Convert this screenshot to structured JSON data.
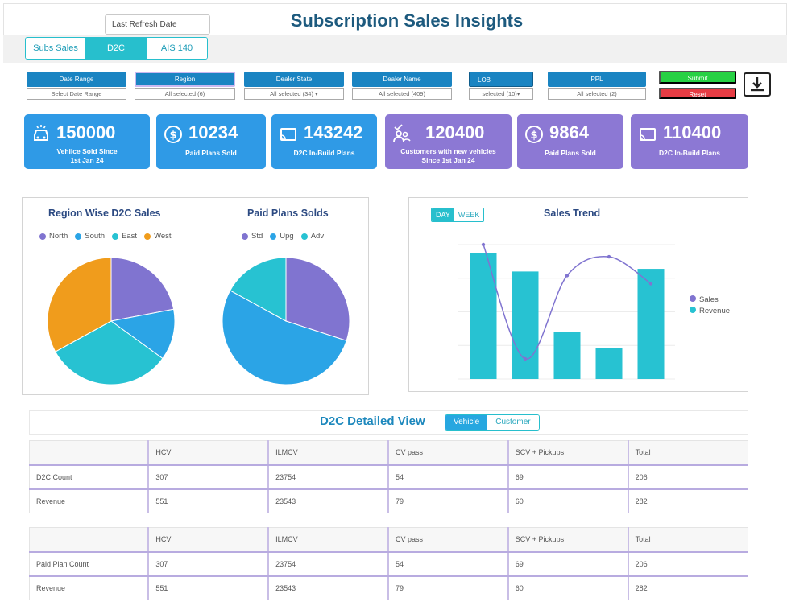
{
  "header": {
    "title": "Subscription Sales Insights",
    "refresh_label": "Last Refresh Date"
  },
  "tabs": [
    {
      "label": "Subs Sales",
      "active": false
    },
    {
      "label": "D2C",
      "active": true
    },
    {
      "label": "AIS 140",
      "active": false
    }
  ],
  "filters": {
    "date_range": {
      "label": "Date Range",
      "value": "Select Date Range"
    },
    "region": {
      "label": "Region",
      "value": "All selected (6)"
    },
    "dealer_state": {
      "label": "Dealer State",
      "value": "All selected (34)"
    },
    "dealer_name": {
      "label": "Dealer Name",
      "value": "All selected (409)"
    },
    "lob": {
      "label": "LOB",
      "value": "selected (10)"
    },
    "ppl": {
      "label": "PPL",
      "value": "All selected (2)"
    },
    "submit_label": "Submit",
    "reset_label": "Reset"
  },
  "kpis": [
    {
      "value": "150000",
      "label": "Vehilce Sold Since 1st Jan 24",
      "icon": "car-icon",
      "color": "#2f9ae6"
    },
    {
      "value": "10234",
      "label": "Paid Plans Sold",
      "icon": "dollar-icon",
      "color": "#2f9ae6"
    },
    {
      "value": "143242",
      "label": "D2C In-Build Plans",
      "icon": "cast-icon",
      "color": "#2f9ae6"
    },
    {
      "value": "120400",
      "label": "Customers with new vehicles Since 1st Jan 24",
      "icon": "users-check-icon",
      "color": "#8c78d4"
    },
    {
      "value": "9864",
      "label": "Paid Plans Sold",
      "icon": "dollar-icon",
      "color": "#8c78d4"
    },
    {
      "value": "110400",
      "label": "D2C In-Build Plans",
      "icon": "cast-icon",
      "color": "#8c78d4"
    }
  ],
  "chart_data": [
    {
      "type": "pie",
      "title": "Region Wise D2C Sales",
      "labels": [
        "North",
        "South",
        "East",
        "West"
      ],
      "colors": [
        "#8074d0",
        "#2ba4e6",
        "#27c2d2",
        "#f09c1c"
      ],
      "values": [
        22,
        13,
        32,
        33
      ]
    },
    {
      "type": "pie",
      "title": "Paid Plans Solds",
      "labels": [
        "Std",
        "Upg",
        "Adv"
      ],
      "colors": [
        "#8074d0",
        "#2ba4e6",
        "#27c2d2"
      ],
      "values": [
        30,
        53,
        17
      ]
    },
    {
      "type": "bar+line",
      "title": "Sales Trend",
      "toggle": [
        "DAY",
        "WEEK"
      ],
      "toggle_active": "DAY",
      "series": [
        {
          "name": "Sales",
          "type": "line",
          "color": "#8074d0",
          "values": [
            100,
            15,
            77,
            91,
            71
          ]
        },
        {
          "name": "Revenue",
          "type": "bar",
          "color": "#27c2d2",
          "values": [
            94,
            80,
            35,
            23,
            82
          ]
        }
      ],
      "ylim": [
        0,
        100
      ],
      "grid": true,
      "legend": "right"
    }
  ],
  "detailed_view": {
    "title": "D2C  Detailed View",
    "toggle": [
      "Vehicle",
      "Customer"
    ],
    "toggle_active": "Vehicle",
    "columns": [
      "",
      "HCV",
      "ILMCV",
      "CV pass",
      "SCV + Pickups",
      "Total"
    ],
    "table1": [
      [
        "D2C Count",
        "307",
        "23754",
        "54",
        "69",
        "206"
      ],
      [
        "Revenue",
        "551",
        "23543",
        "79",
        "60",
        "282"
      ]
    ],
    "table2": [
      [
        "Paid Plan Count",
        "307",
        "23754",
        "54",
        "69",
        "206"
      ],
      [
        "Revenue",
        "551",
        "23543",
        "79",
        "60",
        "282"
      ]
    ]
  }
}
